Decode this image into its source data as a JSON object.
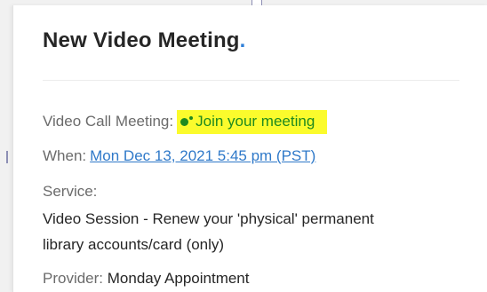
{
  "meeting": {
    "title": "New Video Meeting",
    "title_dot": "."
  },
  "details": {
    "video_call": {
      "label": "Video Call Meeting:",
      "link_text": "Join your meeting",
      "icon": "meeting-dots-icon",
      "highlight_color": "#fbfb2c",
      "link_color": "#1f8a1f"
    },
    "when": {
      "label": "When:",
      "value": "Mon Dec 13, 2021 5:45 pm (PST)",
      "link_color": "#2f79c9"
    },
    "service": {
      "label": "Service:",
      "line1": "Video Session - Renew your 'physical' permanent",
      "line2": "library accounts/card (only)"
    },
    "provider": {
      "label": "Provider:",
      "value": "Monday Appointment"
    }
  },
  "colors": {
    "accent_dot": "#2f7fd8",
    "text": "#262626",
    "label": "#6b6b6b"
  }
}
